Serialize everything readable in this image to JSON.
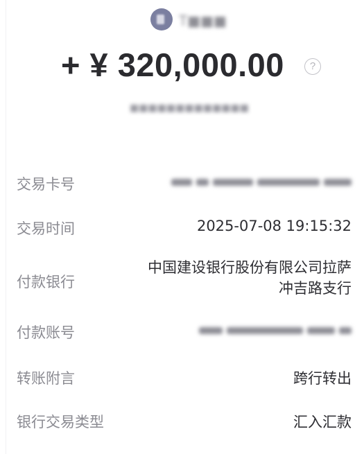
{
  "header": {
    "avatar_icon": "avatar-icon",
    "name": "T■■■"
  },
  "amount": {
    "text": "+ ¥ 320,000.00",
    "help_icon": "question-circle-icon",
    "help_glyph": "?"
  },
  "counterpart": {
    "text": "■■■■■■■■■■■■■"
  },
  "details": [
    {
      "label": "交易卡号",
      "value": "",
      "redacted": true
    },
    {
      "label": "交易时间",
      "value": "2025-07-08 19:15:32"
    },
    {
      "label": "付款银行",
      "value": "中国建设银行股份有限公司拉萨冲吉路支行"
    },
    {
      "label": "付款账号",
      "value": "",
      "redacted": true
    },
    {
      "label": "转账附言",
      "value": "跨行转出"
    },
    {
      "label": "银行交易类型",
      "value": "汇入汇款"
    }
  ],
  "colors": {
    "label": "#8b8b92",
    "value": "#2e2e33",
    "amount": "#2b2b2f",
    "avatar": "#7b7fa0"
  }
}
